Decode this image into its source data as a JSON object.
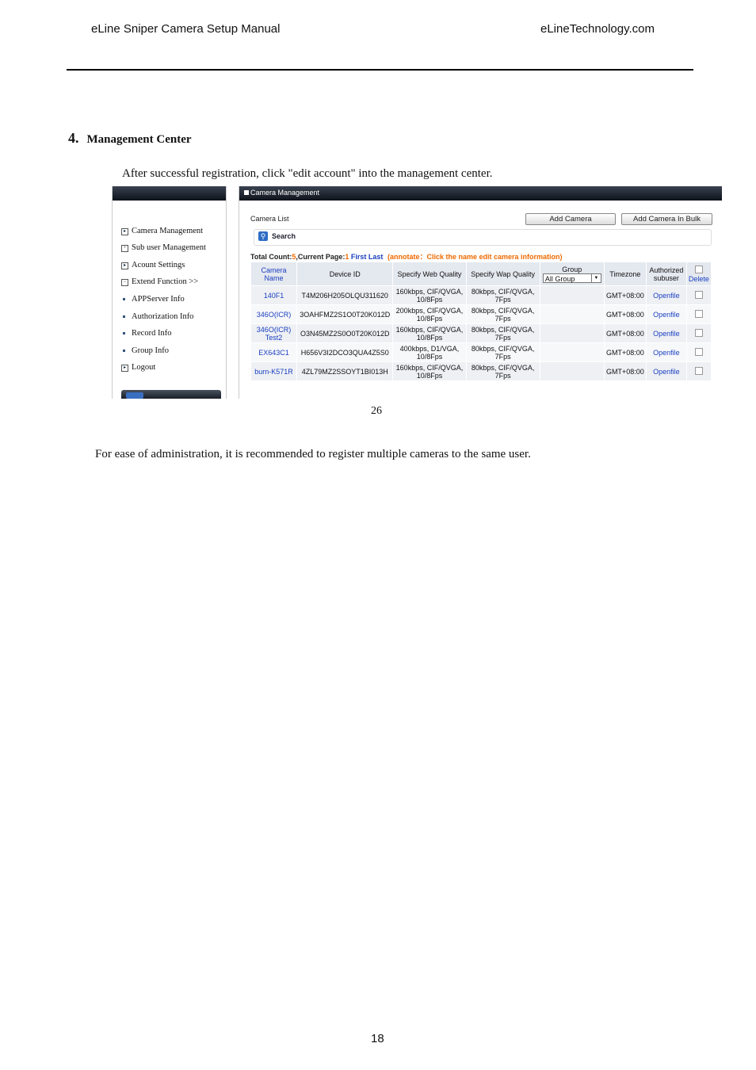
{
  "header": {
    "left": "eLine Sniper Camera Setup Manual",
    "right": "eLineTechnology.com"
  },
  "section": {
    "number": "4.",
    "title": "Management Center"
  },
  "intro_text": "After successful registration, click \"edit account\" into the management center.",
  "screenshot": {
    "sidebar": {
      "items": [
        {
          "label": "Camera Management",
          "icon": "play-icon"
        },
        {
          "label": "Sub user Management",
          "icon": "plus-icon"
        },
        {
          "label": "Acount Settings",
          "icon": "play-icon"
        },
        {
          "label": "Extend Function >>",
          "icon": "minus-icon"
        },
        {
          "label": "APPServer Info",
          "icon": "bullet-icon"
        },
        {
          "label": "Authorization Info",
          "icon": "bullet-icon"
        },
        {
          "label": "Record Info",
          "icon": "bullet-icon"
        },
        {
          "label": "Group Info",
          "icon": "bullet-icon"
        },
        {
          "label": "Logout",
          "icon": "play-icon"
        }
      ]
    },
    "title": "Camera Management",
    "camera_list_label": "Camera List",
    "add_camera": "Add Camera",
    "add_camera_bulk": "Add Camera In Bulk",
    "search_label": "Search",
    "total_prefix": "Total Count:",
    "total_count": "5",
    "current_page_prefix": ",Current Page:",
    "current_page": "1",
    "first": "First",
    "last": "Last",
    "annotate": "(annotate：Click the name edit camera information)",
    "columns": {
      "camera_name": "Camera Name",
      "device_id": "Device ID",
      "web_quality": "Specify Web Quality",
      "wap_quality": "Specify Wap Quality",
      "group": "Group",
      "group_select": "All Group",
      "timezone": "Timezone",
      "authorized": "Authorized subuser",
      "delete": "Delete"
    },
    "rows": [
      {
        "name": "140F1",
        "device_id": "T4M206H205OLQU311620",
        "web": "160kbps, CIF/QVGA, 10/8Fps",
        "wap": "80kbps, CIF/QVGA, 7Fps",
        "group": "",
        "timezone": "GMT+08:00",
        "auth": "Openfile"
      },
      {
        "name": "346O(ICR)",
        "device_id": "3OAHFMZ2S1O0T20K012D",
        "web": "200kbps, CIF/QVGA, 10/8Fps",
        "wap": "80kbps, CIF/QVGA, 7Fps",
        "group": "",
        "timezone": "GMT+08:00",
        "auth": "Openfile"
      },
      {
        "name": "346O(ICR) Test2",
        "device_id": "O3N45MZ2S0O0T20K012D",
        "web": "160kbps, CIF/QVGA, 10/8Fps",
        "wap": "80kbps, CIF/QVGA, 7Fps",
        "group": "",
        "timezone": "GMT+08:00",
        "auth": "Openfile"
      },
      {
        "name": "EX643C1",
        "device_id": "H656V3I2DCO3QUA4Z5S0",
        "web": "400kbps, D1/VGA, 10/8Fps",
        "wap": "80kbps, CIF/QVGA, 7Fps",
        "group": "",
        "timezone": "GMT+08:00",
        "auth": "Openfile"
      },
      {
        "name": "burn-K571R",
        "device_id": "4ZL79MZ2SSOYT1BI013H",
        "web": "160kbps, CIF/QVGA, 10/8Fps",
        "wap": "80kbps, CIF/QVGA, 7Fps",
        "group": "",
        "timezone": "GMT+08:00",
        "auth": "Openfile"
      }
    ]
  },
  "figure_caption": "26",
  "body_text": "For ease of administration, it is recommended to register multiple cameras to the same user.",
  "page_number": "18"
}
